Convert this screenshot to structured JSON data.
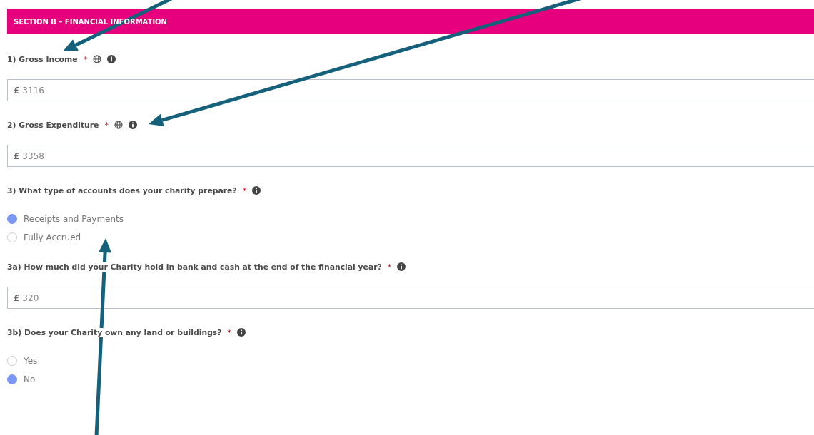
{
  "section": {
    "title": "SECTION B – FINANCIAL INFORMATION"
  },
  "questions": [
    {
      "kind": "amount",
      "label": "1) Gross Income",
      "required_mark": "*",
      "globe_icon": true,
      "currency": "£",
      "value": "3116"
    },
    {
      "kind": "amount",
      "label": "2) Gross Expenditure",
      "required_mark": "*",
      "globe_icon": true,
      "currency": "£",
      "value": "3358"
    },
    {
      "kind": "radio",
      "label": "3) What type of accounts does your charity prepare?",
      "required_mark": "*",
      "globe_icon": false,
      "options": [
        {
          "label": "Receipts and Payments",
          "selected": true
        },
        {
          "label": "Fully Accrued",
          "selected": false
        }
      ]
    },
    {
      "kind": "amount",
      "label": "3a) How much did your Charity hold in bank and cash at the end of the financial year?",
      "required_mark": "*",
      "globe_icon": false,
      "currency": "£",
      "value": "320"
    },
    {
      "kind": "radio",
      "label": "3b) Does your Charity own any land or buildings?",
      "required_mark": "*",
      "globe_icon": false,
      "options": [
        {
          "label": "Yes",
          "selected": false
        },
        {
          "label": "No",
          "selected": true
        }
      ]
    }
  ]
}
